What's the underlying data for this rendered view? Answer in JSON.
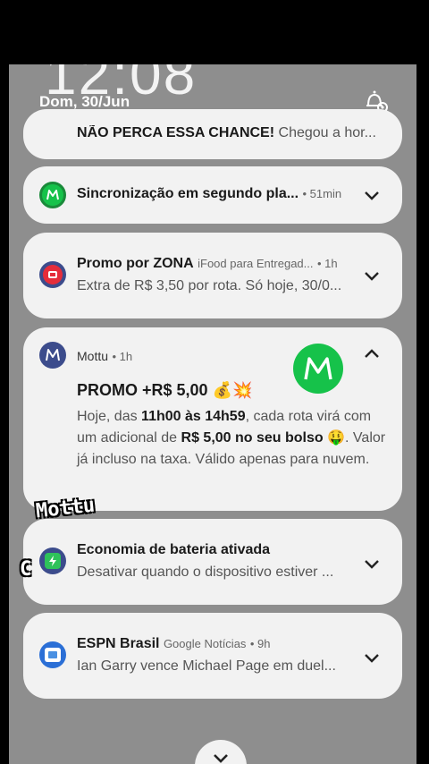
{
  "status": {
    "clock": "12:08",
    "date": "Dom, 30/Jun"
  },
  "notifications": [
    {
      "title": "NÃO PERCA ESSA CHANCE!",
      "body": "Chegou a hor..."
    },
    {
      "title": "Sincronização em segundo pla...",
      "meta": " • 51min"
    },
    {
      "title": "Promo por ZONA",
      "app": "iFood para Entregad...",
      "meta": " • 1h",
      "body": "Extra de R$ 3,50 por rota. Só hoje, 30/0..."
    },
    {
      "app": "Mottu",
      "meta": " • 1h",
      "title": "PROMO +R$ 5,00 💰💥",
      "body_1": "Hoje, das ",
      "body_2": "11h00 às 14h59",
      "body_3": ", cada rota virá com um adicional de ",
      "body_4": "R$ 5,00 no seu bolso",
      "body_5": " 🤑. Valor já incluso na taxa. Válido apenas para nuvem."
    },
    {
      "title": "Economia de bateria ativada",
      "body": "Desativar quando o dispositivo estiver ..."
    },
    {
      "title": "ESPN Brasil",
      "app": "Google Notícias",
      "meta": " • 9h",
      "body": "Ian Garry vence Michael Page em duel..."
    }
  ],
  "overlay": {
    "caption": "Mottu",
    "letter": "C"
  },
  "colors": {
    "mottu_green": "#16c24a",
    "ifood_red": "#e52d3b",
    "mottu_navy": "#3c4c8c"
  }
}
